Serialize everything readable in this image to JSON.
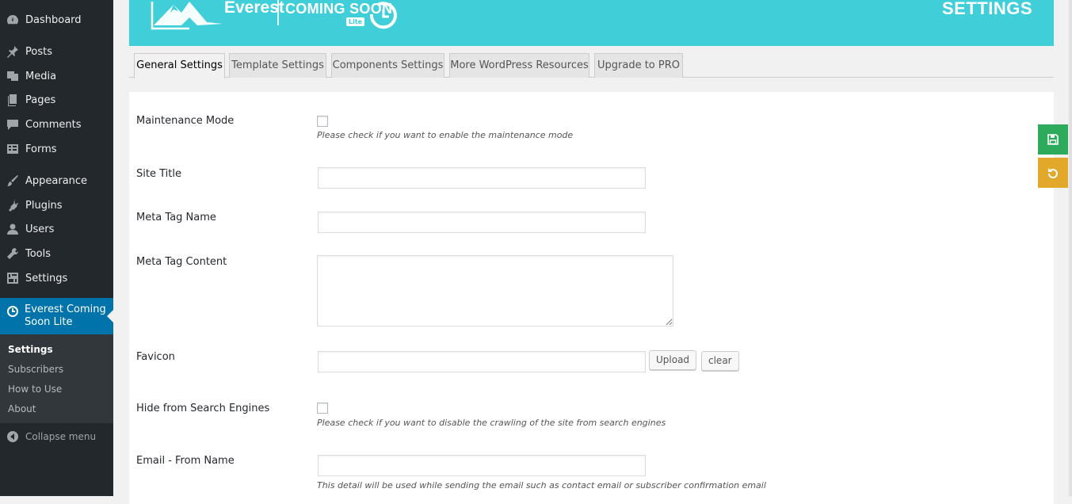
{
  "sidebar": {
    "items": [
      {
        "label": "Dashboard",
        "icon": "dashboard-icon"
      },
      {
        "label": "Posts",
        "icon": "pin-icon"
      },
      {
        "label": "Media",
        "icon": "media-icon"
      },
      {
        "label": "Pages",
        "icon": "pages-icon"
      },
      {
        "label": "Comments",
        "icon": "comment-icon"
      },
      {
        "label": "Forms",
        "icon": "forms-icon"
      },
      {
        "label": "Appearance",
        "icon": "brush-icon"
      },
      {
        "label": "Plugins",
        "icon": "plugin-icon"
      },
      {
        "label": "Users",
        "icon": "user-icon"
      },
      {
        "label": "Tools",
        "icon": "wrench-icon"
      },
      {
        "label": "Settings",
        "icon": "settings-icon"
      }
    ],
    "active": {
      "label": "Everest Coming Soon Lite",
      "icon": "clock-icon"
    },
    "submenu": [
      "Settings",
      "Subscribers",
      "How to Use",
      "About"
    ],
    "collapse_label": "Collapse menu"
  },
  "banner": {
    "logo_name": "Everest",
    "logo_tagline": "COMING SOON",
    "logo_badge": "Lite",
    "title": "SETTINGS",
    "color": "#40ced9"
  },
  "tabs": [
    {
      "label": "General Settings",
      "active": true
    },
    {
      "label": "Template Settings",
      "active": false
    },
    {
      "label": "Components Settings",
      "active": false
    },
    {
      "label": "More WordPress Resources",
      "active": false
    },
    {
      "label": "Upgrade to PRO",
      "active": false
    }
  ],
  "form": {
    "maintenance_mode": {
      "label": "Maintenance Mode",
      "checked": false,
      "help": "Please check if you want to enable the maintenance mode"
    },
    "site_title": {
      "label": "Site Title",
      "value": ""
    },
    "meta_tag_name": {
      "label": "Meta Tag Name",
      "value": ""
    },
    "meta_tag_content": {
      "label": "Meta Tag Content",
      "value": ""
    },
    "favicon": {
      "label": "Favicon",
      "value": "",
      "upload_label": "Upload",
      "clear_label": "clear"
    },
    "hide_search": {
      "label": "Hide from Search Engines",
      "checked": false,
      "help": "Please check if you want to disable the crawling of the site from search engines"
    },
    "email_from_name": {
      "label": "Email - From Name",
      "value": "",
      "help": "This detail will be used while sending the email such as contact email or subscriber confirmation email"
    }
  },
  "actions": {
    "save": {
      "icon": "save-icon",
      "color": "#2eaa5c"
    },
    "reset": {
      "icon": "undo-icon",
      "color": "#e2a82a"
    }
  }
}
